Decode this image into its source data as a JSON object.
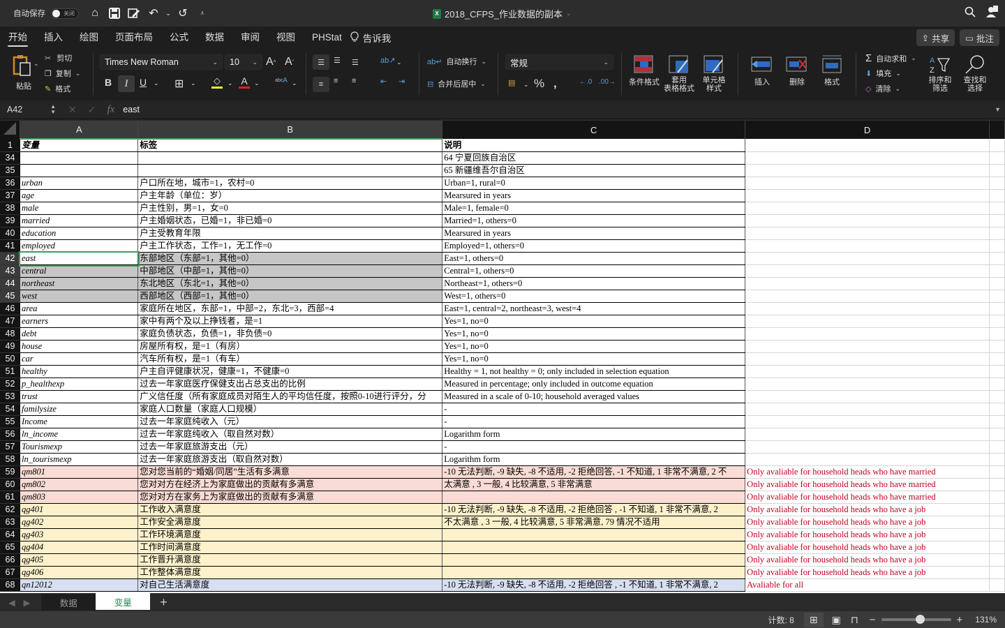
{
  "titlebar": {
    "autosave_label": "自动保存",
    "autosave_state": "关闭",
    "doc_title": "2018_CFPS_作业数据的副本",
    "icons": [
      "home-icon",
      "save-icon",
      "edit-icon",
      "undo-icon",
      "redo-icon",
      "customize-icon",
      "search-icon",
      "account-icon"
    ]
  },
  "ribbon_tabs": [
    {
      "label": "开始",
      "active": true
    },
    {
      "label": "插入"
    },
    {
      "label": "绘图"
    },
    {
      "label": "页面布局"
    },
    {
      "label": "公式"
    },
    {
      "label": "数据"
    },
    {
      "label": "审阅"
    },
    {
      "label": "视图"
    },
    {
      "label": "PHStat"
    }
  ],
  "tell_me": "告诉我",
  "share_label": "共享",
  "comment_label": "批注",
  "ribbon": {
    "paste": "粘贴",
    "cut": "剪切",
    "copy": "复制",
    "format_painter": "格式",
    "font_name": "Times New Roman",
    "font_size": "10",
    "wrap_text": "自动换行",
    "merge_center": "合并后居中",
    "number_format": "常规",
    "conditional_format": "条件格式",
    "table_format_1": "套用",
    "table_format_2": "表格格式",
    "cell_style_1": "单元格",
    "cell_style_2": "样式",
    "insert": "插入",
    "delete": "删除",
    "format": "格式",
    "autosum": "自动求和",
    "fill": "填充",
    "clear": "清除",
    "sort_1": "排序和",
    "sort_2": "筛选",
    "find_1": "查找和",
    "find_2": "选择",
    "colors": {
      "highlight": "#f5ee2a",
      "font_color": "#e02020"
    }
  },
  "formula_bar": {
    "cell_ref": "A42",
    "fx": "fx",
    "value": "east"
  },
  "columns": [
    "A",
    "B",
    "C",
    "D"
  ],
  "rows": [
    {
      "n": "1",
      "a": "变量",
      "b": "标签",
      "c": "说明",
      "d": "",
      "style": "header"
    },
    {
      "n": "34",
      "a": "",
      "b": "",
      "c": "      64 宁夏回族自治区",
      "d": ""
    },
    {
      "n": "35",
      "a": "",
      "b": "",
      "c": "      65 新疆维吾尔自治区",
      "d": ""
    },
    {
      "n": "36",
      "a": "urban",
      "b": "户口所在地，城市=1，农村=0",
      "c": "Urban=1, rural=0",
      "d": ""
    },
    {
      "n": "37",
      "a": "age",
      "b": "户主年龄（单位：岁）",
      "c": "Mearsured in years",
      "d": ""
    },
    {
      "n": "38",
      "a": "male",
      "b": "户主性别，男=1，女=0",
      "c": "Male=1, female=0",
      "d": ""
    },
    {
      "n": "39",
      "a": "married",
      "b": "户主婚姻状态，已婚=1，非已婚=0",
      "c": "Married=1, others=0",
      "d": ""
    },
    {
      "n": "40",
      "a": "education",
      "b": "户主受教育年限",
      "c": "Mearsured in years",
      "d": ""
    },
    {
      "n": "41",
      "a": "employed",
      "b": "户主工作状态，工作=1，无工作=0",
      "c": "Employed=1, others=0",
      "d": ""
    },
    {
      "n": "42",
      "a": "east",
      "b": "东部地区（东部=1，其他=0）",
      "c": "East=1, others=0",
      "d": "",
      "style": "sel-active"
    },
    {
      "n": "43",
      "a": "central",
      "b": "中部地区（中部=1，其他=0）",
      "c": "Central=1, others=0",
      "d": "",
      "style": "sel"
    },
    {
      "n": "44",
      "a": "northeast",
      "b": "东北地区（东北=1，其他=0）",
      "c": "Northeast=1, others=0",
      "d": "",
      "style": "sel"
    },
    {
      "n": "45",
      "a": "west",
      "b": "西部地区（西部=1，其他=0）",
      "c": "West=1, others=0",
      "d": "",
      "style": "sel"
    },
    {
      "n": "46",
      "a": "area",
      "b": "家庭所在地区，东部=1，中部=2，东北=3，西部=4",
      "c": "East=1, central=2, northeast=3, west=4",
      "d": ""
    },
    {
      "n": "47",
      "a": "earners",
      "b": "家中有两个及以上挣钱者，是=1",
      "c": "Yes=1, no=0",
      "d": ""
    },
    {
      "n": "48",
      "a": "debt",
      "b": "家庭负债状态，负债=1，非负债=0",
      "c": "Yes=1, no=0",
      "d": ""
    },
    {
      "n": "49",
      "a": "house",
      "b": "房屋所有权，是=1（有房）",
      "c": "Yes=1, no=0",
      "d": ""
    },
    {
      "n": "50",
      "a": "car",
      "b": "汽车所有权，是=1（有车）",
      "c": "Yes=1, no=0",
      "d": ""
    },
    {
      "n": "51",
      "a": "healthy",
      "b": "户主自评健康状况，健康=1，不健康=0",
      "c": "Healthy = 1, not healthy = 0; only included in selection equation",
      "d": ""
    },
    {
      "n": "52",
      "a": "p_healthexp",
      "b": "过去一年家庭医疗保健支出占总支出的比例",
      "c": "Measured in percentage; only included in outcome equation",
      "d": ""
    },
    {
      "n": "53",
      "a": "trust",
      "b": "广义信任度（所有家庭成员对陌生人的平均信任度，按照0-10进行评分，分",
      "c": "Measured in a scale of 0-10; household averaged values",
      "d": ""
    },
    {
      "n": "54",
      "a": "familysize",
      "b": "家庭人口数量（家庭人口规模）",
      "c": "-",
      "d": ""
    },
    {
      "n": "55",
      "a": "Income",
      "b": "过去一年家庭纯收入（元）",
      "c": "-",
      "d": ""
    },
    {
      "n": "56",
      "a": "ln_income",
      "b": "过去一年家庭纯收入（取自然对数）",
      "c": "Logarithm form",
      "d": ""
    },
    {
      "n": "57",
      "a": "Tourismexp",
      "b": "过去一年家庭旅游支出（元）",
      "c": "-",
      "d": ""
    },
    {
      "n": "58",
      "a": "ln_tourismexp",
      "b": "过去一年家庭旅游支出（取自然对数）",
      "c": "Logarithm form",
      "d": ""
    },
    {
      "n": "59",
      "a": "qm801",
      "b": "您对您当前的“婚姻/同居”生活有多满意",
      "c": "-10 无法判断, -9 缺失, -8 不适用, -2 拒绝回答, -1 不知道, 1 非常不满意, 2 不",
      "d": "Only avaliable for household heads who have married",
      "style": "pink"
    },
    {
      "n": "60",
      "a": "qm802",
      "b": "您对对方在经济上为家庭做出的贡献有多满意",
      "c": "太满意 , 3 一般, 4 比较满意, 5 非常满意",
      "d": "Only avaliable for household heads who have married",
      "style": "pink"
    },
    {
      "n": "61",
      "a": "qm803",
      "b": "您对对方在家务上为家庭做出的贡献有多满意",
      "c": "",
      "d": "Only avaliable for household heads who have married",
      "style": "pink"
    },
    {
      "n": "62",
      "a": "qg401",
      "b": "工作收入满意度",
      "c": "-10 无法判断, -9 缺失, -8 不适用, -2 拒绝回答 , -1 不知道, 1 非常不满意, 2",
      "d": "Only avaliable for household heads who have a job",
      "style": "yellow"
    },
    {
      "n": "63",
      "a": "qg402",
      "b": "工作安全满意度",
      "c": "不太满意 , 3 一般, 4 比较满意, 5 非常满意, 79 情况不适用",
      "d": "Only avaliable for household heads who have a job",
      "style": "yellow"
    },
    {
      "n": "64",
      "a": "qg403",
      "b": "工作环境满意度",
      "c": "",
      "d": "Only avaliable for household heads who have a job",
      "style": "yellow"
    },
    {
      "n": "65",
      "a": "qg404",
      "b": "工作时间满意度",
      "c": "",
      "d": "Only avaliable for household heads who have a job",
      "style": "yellow"
    },
    {
      "n": "66",
      "a": "qg405",
      "b": "工作晋升满意度",
      "c": "",
      "d": "Only avaliable for household heads who have a job",
      "style": "yellow"
    },
    {
      "n": "67",
      "a": "qg406",
      "b": "工作整体满意度",
      "c": "",
      "d": "Only avaliable for household heads who have a job",
      "style": "yellow"
    },
    {
      "n": "68",
      "a": "qn12012",
      "b": "对自己生活满意度",
      "c": "-10 无法判断, -9 缺失, -8 不适用, -2 拒绝回答 , -1 不知道, 1 非常不满意, 2",
      "d": "Avaliable for all",
      "style": "blue"
    }
  ],
  "sheet_tabs": [
    {
      "label": "数据",
      "active": false
    },
    {
      "label": "变量",
      "active": true
    }
  ],
  "status": {
    "count_label": "计数: 8",
    "zoom": "131%",
    "zoom_fraction": 0.55
  }
}
